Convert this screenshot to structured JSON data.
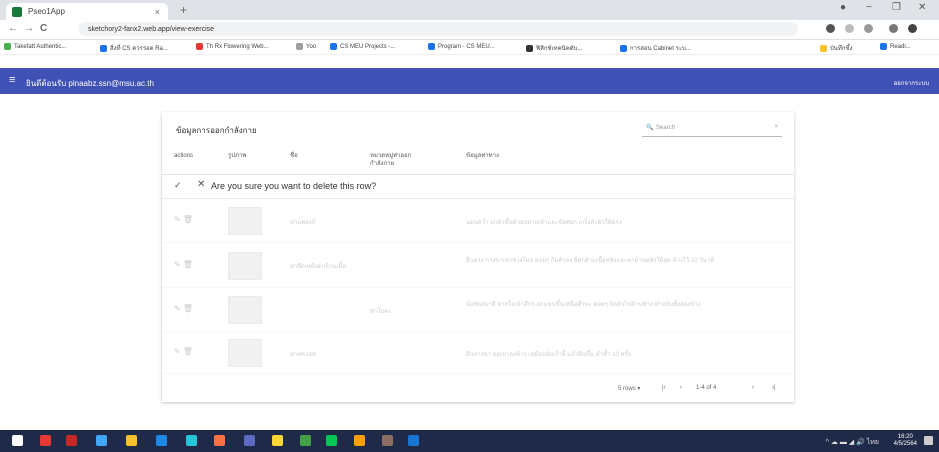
{
  "browser": {
    "tab_title": "Pseo1App",
    "tab_close": "×",
    "new_tab": "+",
    "window_controls": {
      "minimize": "−",
      "maximize": "❐",
      "close": "✕"
    },
    "nav": {
      "back": "←",
      "forward": "→",
      "reload": "C"
    },
    "url": "sketchory2-fanx2.web.app/view-exercise",
    "bookmarks": [
      {
        "label": "Takefatt Authentic...",
        "color": "#4caf50"
      },
      {
        "label": "สิ่งที่ CS ควรรอด Ra...",
        "color": "#1a73e8"
      },
      {
        "label": "Th Rx Flowering Web...",
        "color": "#e53935"
      },
      {
        "label": "Yoo",
        "color": "#9e9e9e"
      },
      {
        "label": "CS MEU Projects -...",
        "color": "#1a73e8"
      },
      {
        "label": "Program - CS MEU...",
        "color": "#1a73e8"
      },
      {
        "label": "ฟิสิกซ์เทคนิคดับ...",
        "color": "#333333"
      },
      {
        "label": "การสอน Cabinet ระบ...",
        "color": "#1a73e8"
      },
      {
        "label": "บันทึกซึ้ง",
        "color": "#fbc02d"
      },
      {
        "label": "Readi...",
        "color": "#1a73e8"
      }
    ]
  },
  "appbar": {
    "menu_icon": "≡",
    "title": "ยินดีต้อนรับ pinaabz.ssn@msu.ac.th",
    "right_text": "ออกจากระบบ"
  },
  "card": {
    "title": "ข้อมูลการออกกำลังกาย",
    "search": {
      "icon": "🔍",
      "placeholder": "Search",
      "clear": "×"
    },
    "columns": [
      "actions",
      "รูปภาพ",
      "ชื่อ",
      "หมวดหมู่ท่าออกกำลังกาย",
      "ข้อมูลท่าทาง"
    ],
    "confirm": {
      "ok": "✓",
      "cancel": "✕",
      "message": "Are you sure you want to delete this row?"
    },
    "rows": [
      {
        "icons": "✎ 🗑",
        "name": "ท่าแพลงก์",
        "category": "",
        "detail": "นอนคว่ำ ยกตัวขึ้นด้วยปลายเท้าและข้อศอก เกร็งลำตัวให้ตรง"
      },
      {
        "icons": "✎ 🗑",
        "name": "",
        "category": "ท่ายืดเหยียดกล้ามเนื้อ",
        "detail": "ยืนตรง กางขาเท่าช่วงไหล่ ค่อยๆ ก้มตัวลง ยืดกล้ามเนื้อหลังและขาด้านหลังให้สุด ค้างไว้ 10 วินาที"
      },
      {
        "icons": "✎ 🗑",
        "name": "",
        "category": "ท่าโยคะ",
        "detail": "นั่งขัดสมาธิ หายใจเข้าลึกๆ ยกแขนขึ้นเหนือศีรษะ ค่อยๆ บิดตัวไปด้านข้าง ทำสลับทั้งสองข้าง"
      },
      {
        "icons": "✎ 🗑",
        "name": "ท่าสควอท",
        "category": "",
        "detail": "ยืนกางขา ย่อเข่าลงช้าๆ เหมือนนั่งเก้าอี้ แล้วยืนขึ้น ทำซ้ำ 10 ครั้ง"
      }
    ],
    "footer": {
      "rows_per_page": "5 rows ▾",
      "first": "|‹",
      "prev": "‹",
      "range": "1-4 of 4",
      "next": "›",
      "last": "›|"
    }
  },
  "taskbar": {
    "icons": [
      {
        "name": "windows-start-icon",
        "color": "#ffffff"
      },
      {
        "name": "youtube-icon",
        "color": "#e53935"
      },
      {
        "name": "red-app-icon",
        "color": "#c62828"
      },
      {
        "name": "store-icon",
        "color": "#42a5f5"
      },
      {
        "name": "chrome-icon",
        "color": "#fbc02d"
      },
      {
        "name": "word-icon",
        "color": "#1e88e5"
      },
      {
        "name": "edge-icon",
        "color": "#26c6da"
      },
      {
        "name": "firefox-icon",
        "color": "#ff7043"
      },
      {
        "name": "teams-icon",
        "color": "#5c6bc0"
      },
      {
        "name": "folder-icon",
        "color": "#fdd835"
      },
      {
        "name": "excel-icon",
        "color": "#43a047"
      },
      {
        "name": "line-icon",
        "color": "#00c853"
      },
      {
        "name": "mail-icon",
        "color": "#ffa000"
      },
      {
        "name": "photos-icon",
        "color": "#8d6e63"
      },
      {
        "name": "vscode-icon",
        "color": "#1976d2"
      }
    ],
    "tray_text": "^ ☁ ▬ ◢ 🔊 ไทย",
    "time": "16:20",
    "date": "4/5/2564"
  },
  "colors": {
    "appbar": "#3f51b5",
    "taskbar": "#1f2a48"
  }
}
